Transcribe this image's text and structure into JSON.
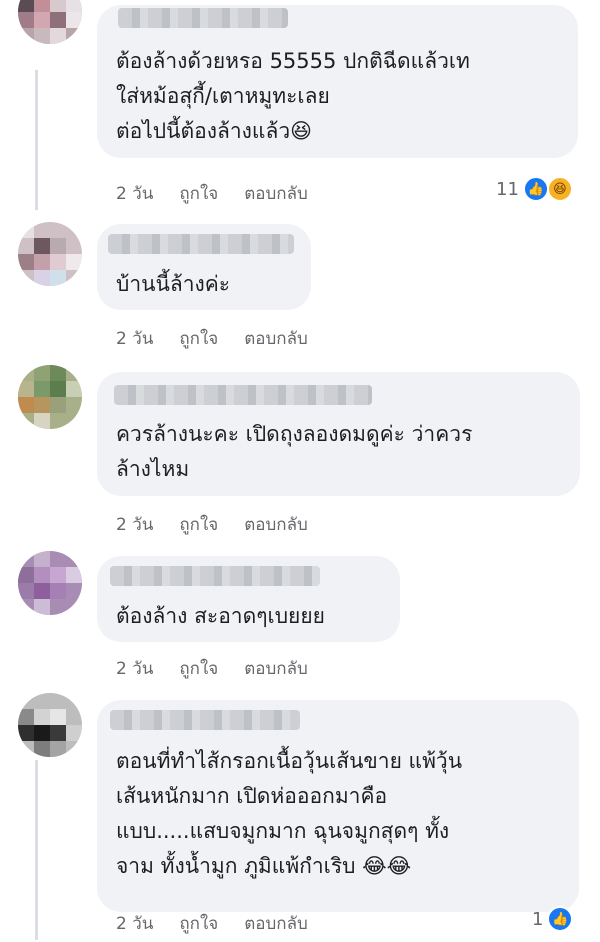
{
  "comments": [
    {
      "text": "ต้องล้างด้วยหรอ 55555 ปกติฉีดแล้วเท\nใส่หม้อสุกี้/เตาหมูทะเลย\nต่อไปนี้ต้องล้างแล้ว😆",
      "time": "2 วัน",
      "like": "ถูกใจ",
      "reply": "ตอบกลับ",
      "reaction_count": "11",
      "reactions": [
        "like-icon",
        "haha-icon"
      ]
    },
    {
      "text": "บ้านนี้ล้างค่ะ",
      "time": "2 วัน",
      "like": "ถูกใจ",
      "reply": "ตอบกลับ"
    },
    {
      "text": "ควรล้างนะคะ เปิดถุงลองดมดูค่ะ ว่าควร\nล้างไหม",
      "time": "2 วัน",
      "like": "ถูกใจ",
      "reply": "ตอบกลับ"
    },
    {
      "text": "ต้องล้าง สะอาดๆเบยยย",
      "time": "2 วัน",
      "like": "ถูกใจ",
      "reply": "ตอบกลับ"
    },
    {
      "text": "ตอนที่ทำไส้กรอกเนื้อวุ้นเส้นขาย แพ้วุ้น\nเส้นหนักมาก เปิดห่อออกมาคือ\nแบบ.....แสบจมูกมาก ฉุนจมูกสุดๆ ทั้ง\nจาม ทั้งน้ำมูก ภูมิแพ้กำเริบ 😂😂",
      "time": "2 วัน",
      "like": "ถูกใจ",
      "reply": "ตอบกลับ",
      "reaction_count": "1",
      "reactions": [
        "like-icon"
      ]
    }
  ],
  "colors": {
    "bubble": "#f0f2f5",
    "meta": "#65676b",
    "like": "#1877f2",
    "haha": "#f7b125"
  }
}
